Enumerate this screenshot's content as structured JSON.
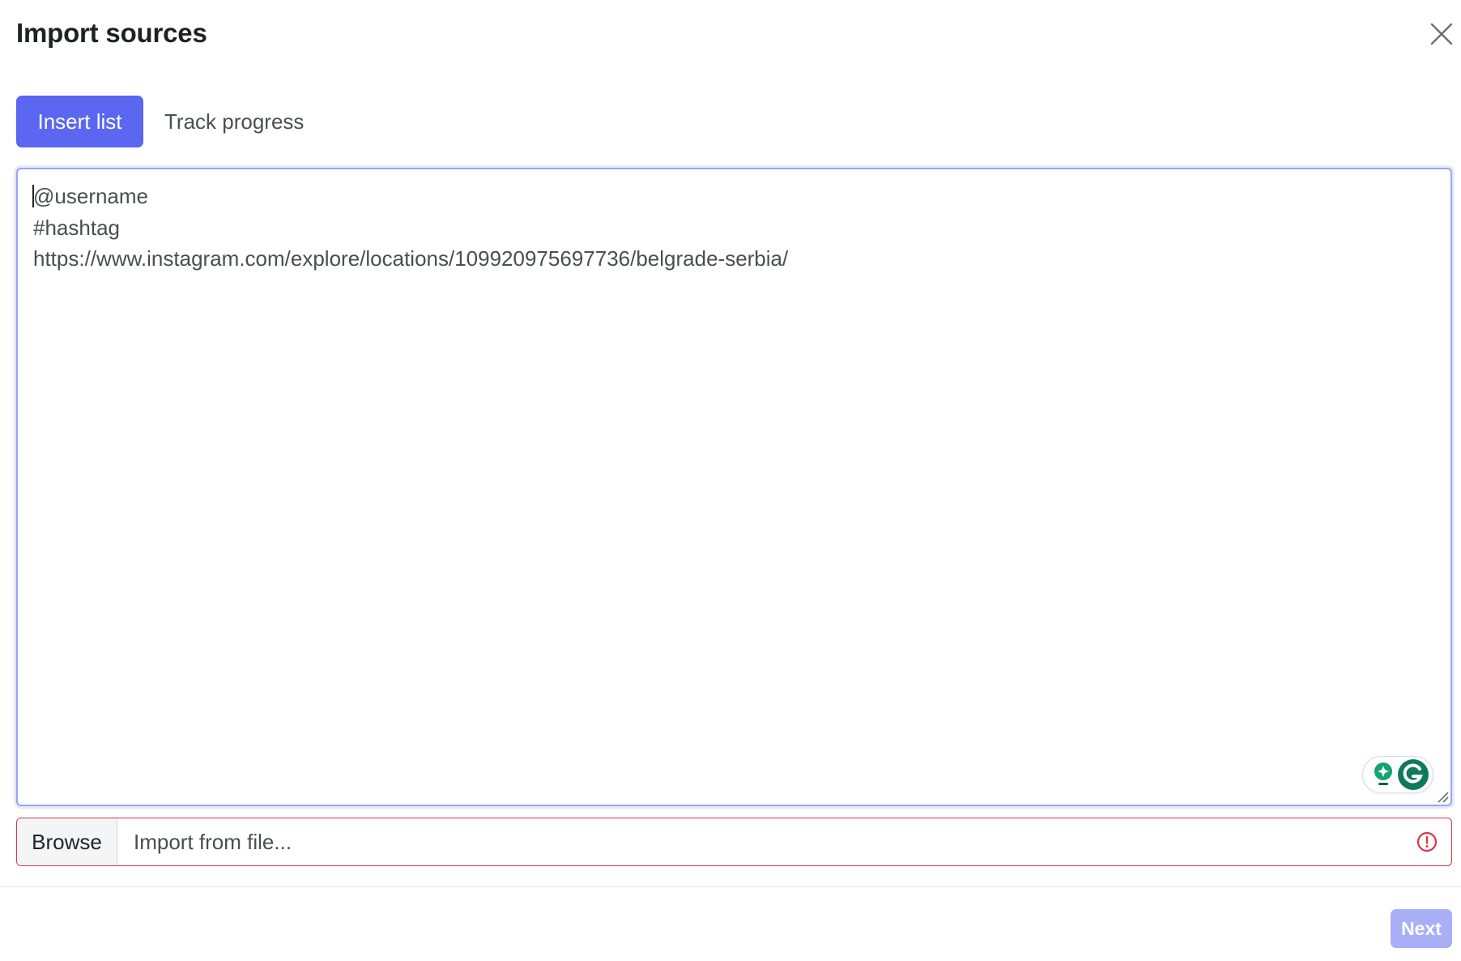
{
  "dialog": {
    "title": "Import sources",
    "close_icon": "close-icon"
  },
  "tabs": [
    {
      "label": "Insert list",
      "active": true
    },
    {
      "label": "Track progress",
      "active": false
    }
  ],
  "list_input": {
    "value": "@username\n#hashtag\nhttps://www.instagram.com/explore/locations/109920975697736/belgrade-serbia/",
    "focus_border_color": "#9aa4f2",
    "extension_icons": [
      "grammarly-suggestion-icon",
      "grammarly-icon"
    ]
  },
  "file_input": {
    "browse_label": "Browse",
    "placeholder": "Import from file...",
    "state": "invalid",
    "error_color": "#dc3545",
    "status_icon": "error-circle-icon"
  },
  "footer": {
    "next_label": "Next",
    "next_disabled": true
  },
  "colors": {
    "primary": "#5b67f0",
    "primary_disabled": "#a8aff6",
    "danger": "#dc3545",
    "grammarly_green": "#15a371"
  }
}
